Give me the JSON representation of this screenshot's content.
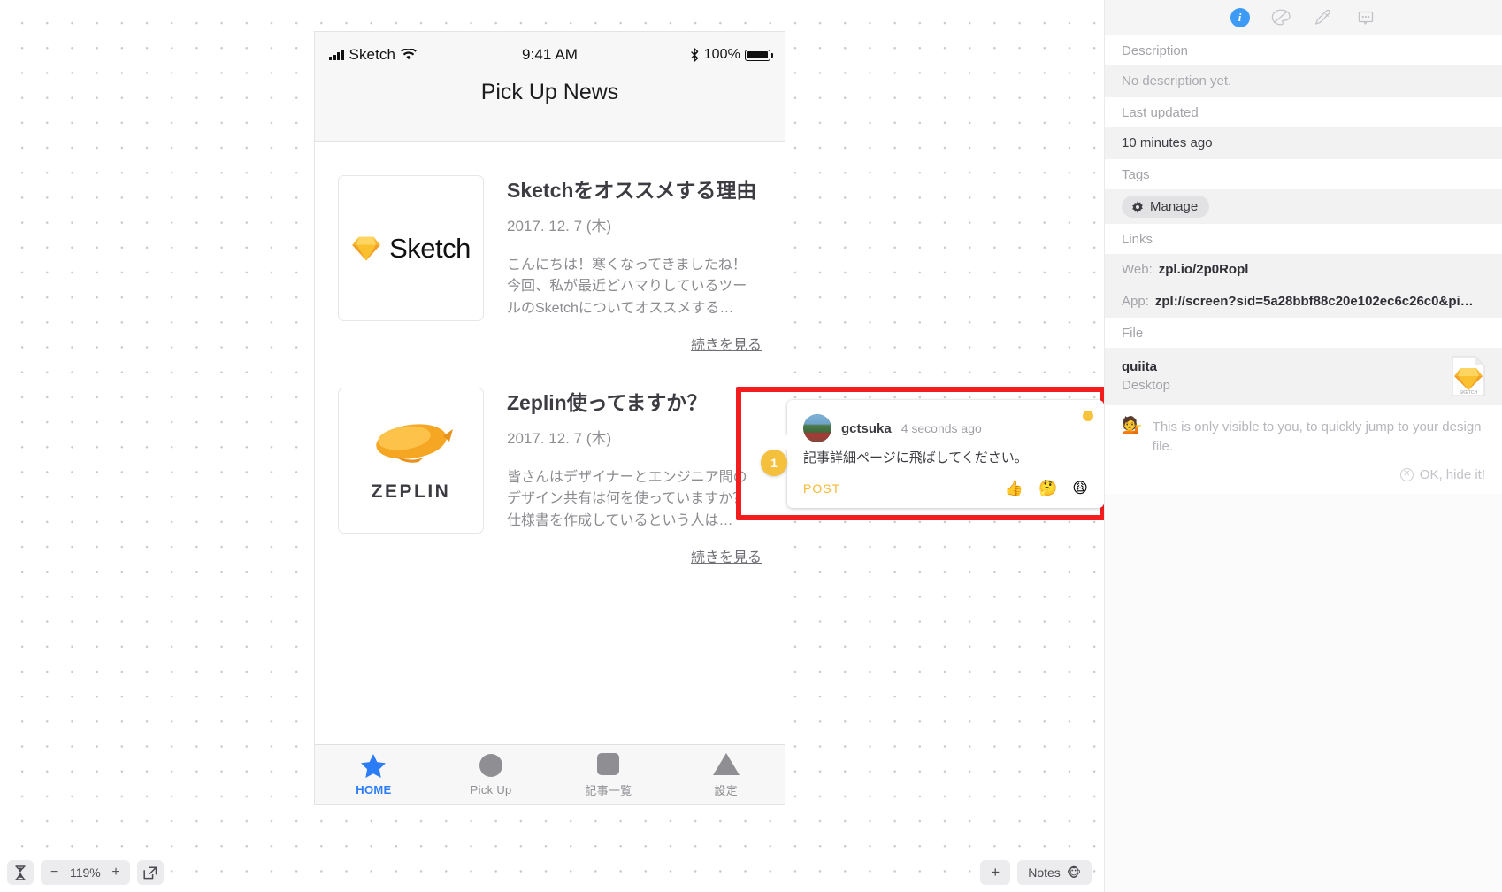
{
  "canvas": {
    "zoom_controls": {
      "fit_icon": "hourglass-icon",
      "minus_label": "−",
      "zoom_level": "119%",
      "plus_label": "+",
      "fullscreen_icon": "external-link-icon"
    },
    "notes_bar": {
      "add_label": "+",
      "notes_label": "Notes",
      "notes_emoji": "🐵"
    }
  },
  "artboard": {
    "status_bar": {
      "carrier": "Sketch",
      "signal_icon": "signal-bars-icon",
      "wifi_icon": "wifi-icon",
      "time": "9:41 AM",
      "bluetooth_icon": "bluetooth-icon",
      "battery_percent": "100%",
      "battery_icon": "battery-full-icon"
    },
    "nav_title": "Pick Up News",
    "articles": [
      {
        "logo_name": "sketch-logo",
        "logo_text": "Sketch",
        "title": "Sketchをオススメする理由",
        "date": "2017. 12. 7 (木)",
        "excerpt": "こんにちは！寒くなってきましたね！\n今回、私が最近どハマりしているツー\nルのSketchについてオススメする…",
        "more_label": "続きを見る"
      },
      {
        "logo_name": "zeplin-logo",
        "logo_text": "ZEPLIN",
        "title": "Zeplin使ってますか？",
        "date": "2017. 12. 7 (木)",
        "excerpt": "皆さんはデザイナーとエンジニア間の\nデザイン共有は何を使っていますか？\n仕様書を作成しているという人は…",
        "more_label": "続きを見る"
      }
    ],
    "tabs": [
      {
        "icon": "star-icon",
        "label": "HOME",
        "active": true
      },
      {
        "icon": "circle-icon",
        "label": "Pick Up",
        "active": false
      },
      {
        "icon": "square-icon",
        "label": "記事一覧",
        "active": false
      },
      {
        "icon": "triangle-icon",
        "label": "設定",
        "active": false
      }
    ]
  },
  "comment": {
    "pin_number": "1",
    "author": "gctsuka",
    "timestamp": "4 seconds ago",
    "body": "記事詳細ページに飛ばしてください。",
    "post_label": "POST",
    "reactions": [
      "👍",
      "🤔",
      "😩"
    ],
    "avatar_name": "user-avatar",
    "unread_dot": "unread-dot"
  },
  "panel": {
    "toolbar": [
      {
        "icon": "info-icon",
        "glyph": "i",
        "active": true
      },
      {
        "icon": "palette-icon",
        "glyph": "",
        "active": false
      },
      {
        "icon": "eyedropper-icon",
        "glyph": "",
        "active": false
      },
      {
        "icon": "comment-icon",
        "glyph": "",
        "active": false
      }
    ],
    "description": {
      "label": "Description",
      "value": "No description yet."
    },
    "last_updated": {
      "label": "Last updated",
      "value": "10 minutes ago"
    },
    "tags": {
      "label": "Tags",
      "manage_label": "Manage",
      "manage_icon": "gear-icon"
    },
    "links": {
      "label": "Links",
      "web_key": "Web:",
      "web_value": "zpl.io/2p0Ropl",
      "app_key": "App:",
      "app_value": "zpl://screen?sid=5a28bbf88c20e102ec6c26c0&pi…"
    },
    "file": {
      "label": "File",
      "name": "quiita",
      "location": "Desktop",
      "icon": "sketch-file-icon",
      "icon_caption": "SKETCH"
    },
    "notice": {
      "emoji": "💁",
      "text": "This is only visible to you, to quickly jump to your design file.",
      "hide_label": "OK, hide it!",
      "hide_icon": "close-circle-icon"
    }
  },
  "colors": {
    "accent_blue": "#3d9bf5",
    "comment_yellow": "#f5c03c",
    "highlight_red": "#f41c1c",
    "tab_active": "#2b7cf6"
  }
}
